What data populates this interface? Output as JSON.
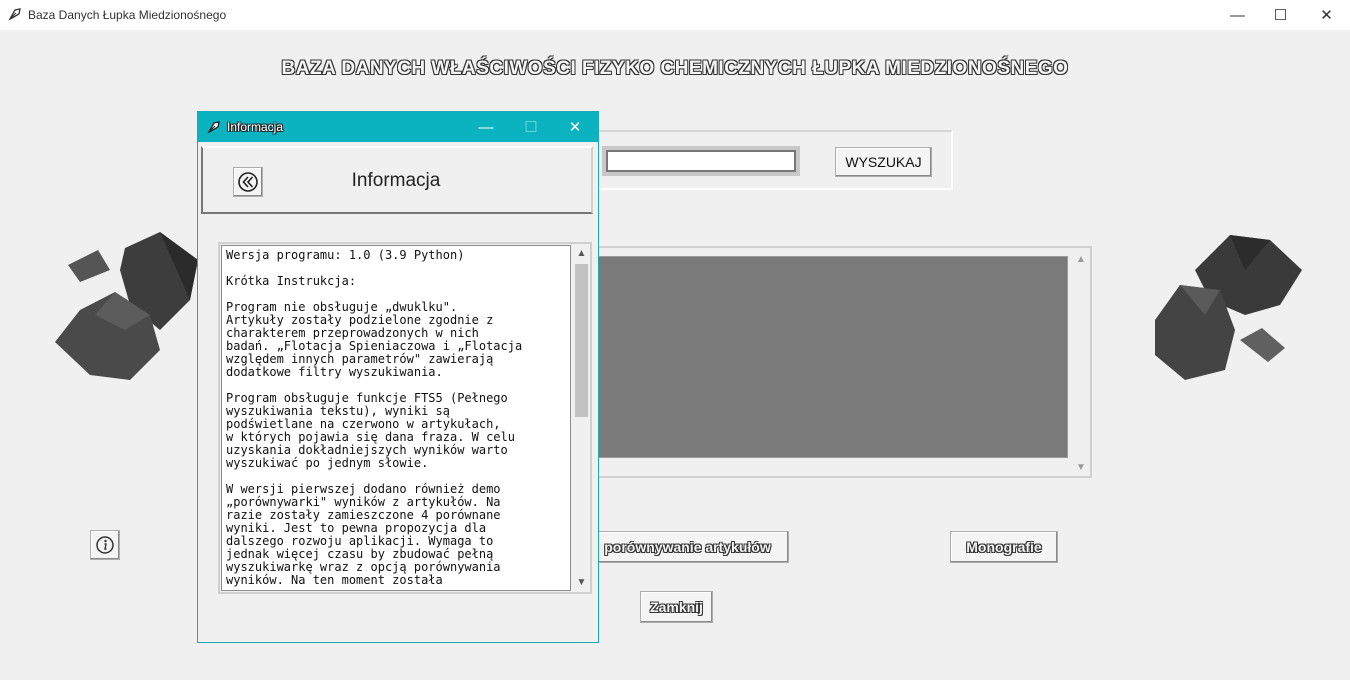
{
  "window": {
    "title": "Baza Danych Łupka Miedzionośnego",
    "minimize": "—",
    "maximize": "☐",
    "close": "✕"
  },
  "main": {
    "heading": "BAZA DANYCH WŁAŚCIWOŚCI FIZYKO CHEMICZNYCH ŁUPKA MIEDZIONOŚNEGO",
    "search_value": "",
    "search_button": "WYSZUKAJ",
    "compare_button": "porównywanie artykułów",
    "monografie_button": "Monografie",
    "close_button": "Zamknij"
  },
  "dialog": {
    "title": "Informacja",
    "heading": "Informacja",
    "minimize": "—",
    "maximize": "☐",
    "close": "✕",
    "text": "Wersja programu: 1.0 (3.9 Python)\n\nKrótka Instrukcja:\n\nProgram nie obsługuje „dwuklku\".\nArtykuły zostały podzielone zgodnie z\ncharakterem przeprowadzonych w nich\nbadań. „Flotacja Spieniaczowa i „Flotacja\nwzględem innych parametrów\" zawierają\ndodatkowe filtry wyszukiwania.\n\nProgram obsługuje funkcje FTS5 (Pełnego\nwyszukiwania tekstu), wyniki są\npodświetlane na czerwono w artykułach,\nw których pojawia się dana fraza. W celu\nuzyskania dokładniejszych wyników warto\nwyszukiwać po jednym słowie.\n\nW wersji pierwszej dodano również demo\n„porównywarki\" wyników z artykułów. Na\nrazie zostały zamieszczone 4 porównane\nwyniki. Jest to pewna propozycja dla\ndalszego rozwoju aplikacji. Wymaga to\njednak więcej czasu by zbudować pełną\nwyszukiwarkę wraz z opcją porównywania\nwyników. Na ten moment została"
  },
  "colors": {
    "dialog_titlebar": "#0bb3c1",
    "rock_dark": "#3a3a3a",
    "rock_mid": "#555555",
    "results_bg": "#7a7a7a"
  },
  "icons": {
    "app": "feather-app-icon",
    "info": "info-icon",
    "back": "double-chevron-left-icon"
  }
}
